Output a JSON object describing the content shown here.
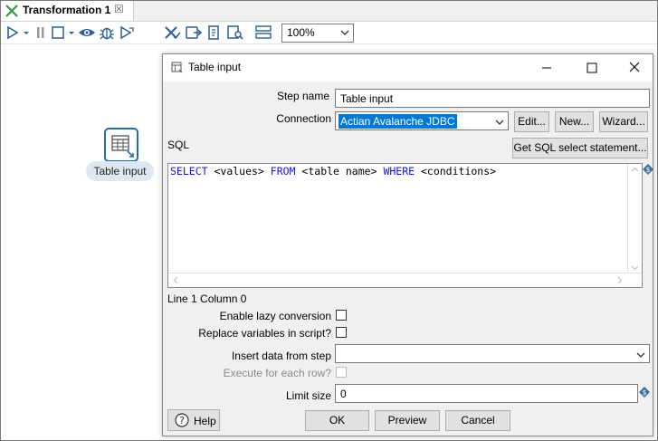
{
  "tab": {
    "title": "Transformation 1",
    "close": "☒"
  },
  "toolbar": {
    "zoom": "100%"
  },
  "canvas": {
    "step_label": "Table input"
  },
  "dialog": {
    "title": "Table input",
    "step_name_label": "Step name",
    "step_name_value": "Table input",
    "connection_label": "Connection",
    "connection_value": "Actian Avalanche JDBC",
    "edit_button": "Edit...",
    "new_button": "New...",
    "wizard_button": "Wizard...",
    "sql_label": "SQL",
    "get_sql_button": "Get SQL select statement...",
    "sql_tokens": {
      "select": "SELECT",
      "values": " <values> ",
      "from": "FROM",
      "table": " <table name> ",
      "where": "WHERE",
      "conditions": " <conditions>"
    },
    "position_status": "Line 1 Column 0",
    "lazy_label": "Enable lazy conversion",
    "replace_vars_label": "Replace variables in script?",
    "insert_from_step_label": "Insert data from step",
    "insert_from_step_value": "",
    "execute_each_row_label": "Execute for each row?",
    "limit_size_label": "Limit size",
    "limit_size_value": "0",
    "help_button": "Help",
    "ok_button": "OK",
    "preview_button": "Preview",
    "cancel_button": "Cancel"
  },
  "colors": {
    "accent": "#1f6fb8",
    "sql_keyword": "#1010ff",
    "selection": "#0078d7"
  }
}
